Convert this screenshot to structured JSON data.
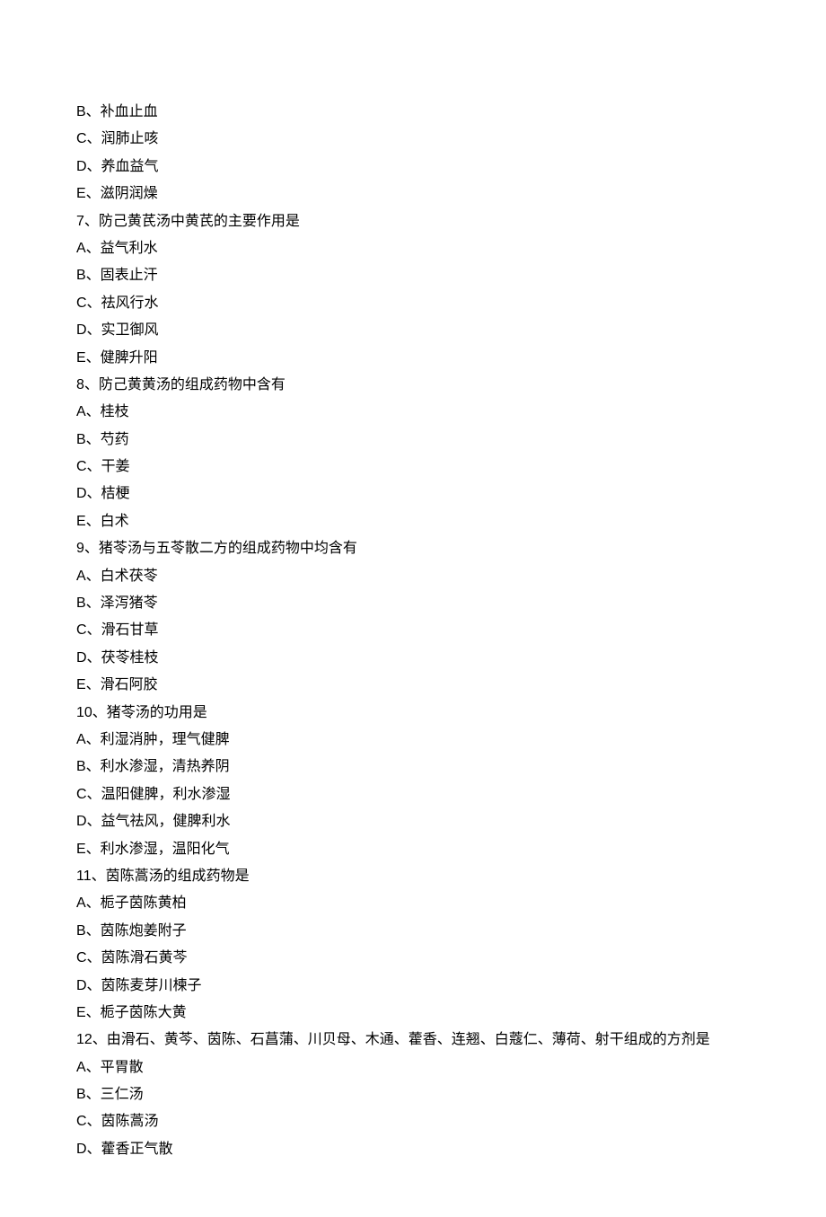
{
  "lines": [
    "B、补血止血",
    "C、润肺止咳",
    "D、养血益气",
    "E、滋阴润燥",
    "7、防己黄芪汤中黄芪的主要作用是",
    "A、益气利水",
    "B、固表止汗",
    "C、祛风行水",
    "D、实卫御风",
    "E、健脾升阳",
    "8、防己黄黄汤的组成药物中含有",
    "A、桂枝",
    "B、芍药",
    "C、干姜",
    "D、桔梗",
    "E、白术",
    "9、猪苓汤与五苓散二方的组成药物中均含有",
    "A、白术茯苓",
    "B、泽泻猪苓",
    "C、滑石甘草",
    "D、茯苓桂枝",
    "E、滑石阿胶",
    "10、猪苓汤的功用是",
    "A、利湿消肿，理气健脾",
    "B、利水渗湿，清热养阴",
    "C、温阳健脾，利水渗湿",
    "D、益气祛风，健脾利水",
    "E、利水渗湿，温阳化气",
    "11、茵陈蒿汤的组成药物是",
    "A、栀子茵陈黄柏",
    "B、茵陈炮姜附子",
    "C、茵陈滑石黄芩",
    "D、茵陈麦芽川楝子",
    "E、栀子茵陈大黄",
    "12、由滑石、黄芩、茵陈、石菖蒲、川贝母、木通、藿香、连翘、白蔻仁、薄荷、射干组成的方剂是",
    "A、平胃散",
    "B、三仁汤",
    "C、茵陈蒿汤",
    "D、藿香正气散"
  ]
}
